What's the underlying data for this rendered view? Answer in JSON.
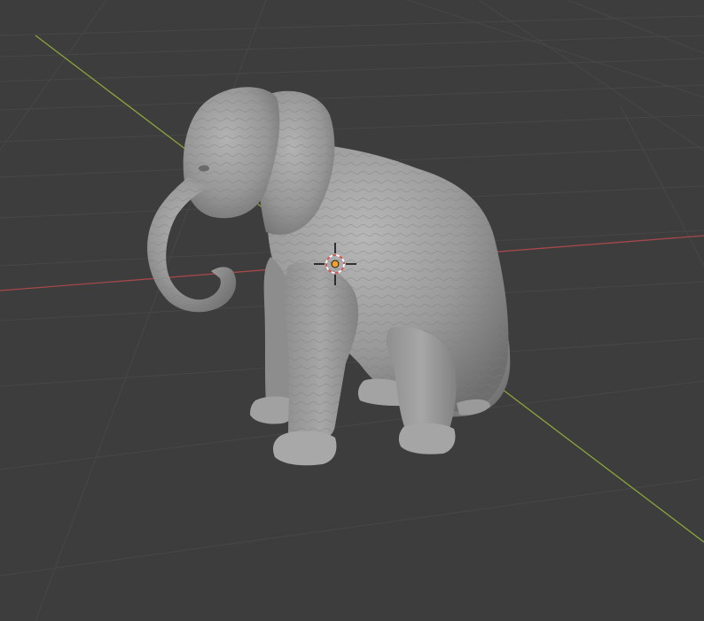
{
  "app": {
    "name": "",
    "view": "3D Viewport",
    "overlay_text": ""
  },
  "viewport": {
    "background_color": "#3d3d3d",
    "grid_color": "#4a4a4a",
    "x_axis_color": "#a5484c",
    "y_axis_color": "#8aa53a",
    "model_color": "#9b9b9b"
  },
  "scene": {
    "object": "elephant-sculpt",
    "cursor": "3d-cursor"
  }
}
